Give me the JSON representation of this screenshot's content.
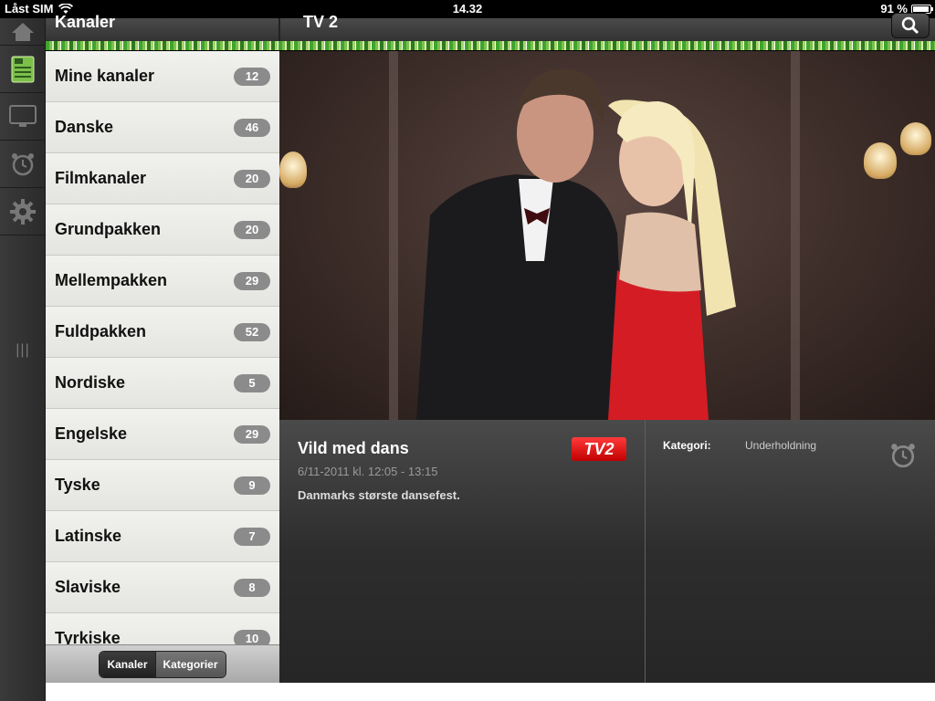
{
  "status": {
    "carrier": "Låst SIM",
    "time": "14.32",
    "battery": "91 %"
  },
  "header": {
    "left_title": "Kanaler",
    "center_title": "TV 2"
  },
  "rail": {
    "icons": [
      "home-icon",
      "tv-guide-icon",
      "monitor-icon",
      "alarm-clock-icon",
      "gear-icon"
    ],
    "grip": "|||"
  },
  "channels": [
    {
      "name": "Mine kanaler",
      "count": "12"
    },
    {
      "name": "Danske",
      "count": "46"
    },
    {
      "name": "Filmkanaler",
      "count": "20"
    },
    {
      "name": "Grundpakken",
      "count": "20"
    },
    {
      "name": "Mellempakken",
      "count": "29"
    },
    {
      "name": "Fuldpakken",
      "count": "52"
    },
    {
      "name": "Nordiske",
      "count": "5"
    },
    {
      "name": "Engelske",
      "count": "29"
    },
    {
      "name": "Tyske",
      "count": "9"
    },
    {
      "name": "Latinske",
      "count": "7"
    },
    {
      "name": "Slaviske",
      "count": "8"
    },
    {
      "name": "Tyrkiske",
      "count": "10"
    }
  ],
  "toolbar": {
    "tab_channels": "Kanaler",
    "tab_categories": "Kategorier"
  },
  "program": {
    "title": "Vild med dans",
    "time": "6/11-2011 kl. 12:05 - 13:15",
    "description": "Danmarks største dansefest.",
    "channel_logo": "TV2",
    "category_label": "Kategori:",
    "category_value": "Underholdning"
  },
  "colors": {
    "accent_green": "#3ea52d",
    "logo_red": "#d40000"
  }
}
